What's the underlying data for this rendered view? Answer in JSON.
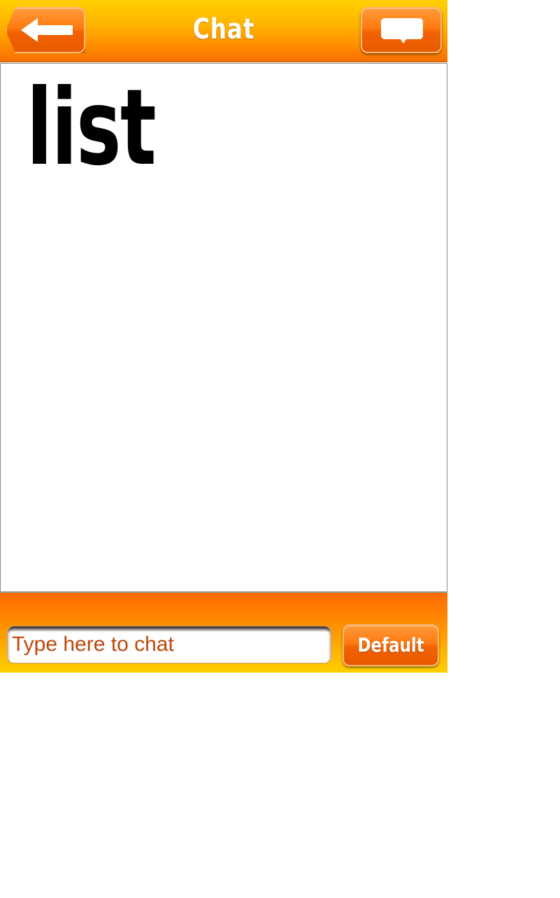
{
  "header": {
    "title": "Chat",
    "back_icon": "arrow-left-icon",
    "action_icon": "speech-bubble-icon"
  },
  "chat_list": {
    "text": "list"
  },
  "footer": {
    "input_placeholder": "Type here to chat",
    "input_value": "",
    "default_button_label": "Default"
  },
  "colors": {
    "header_top": "#ffd000",
    "header_bottom": "#f57000",
    "button_orange": "#f26200",
    "placeholder_text": "#c0470a",
    "footer_top": "#ff6a00",
    "footer_bottom": "#ffcf00"
  }
}
